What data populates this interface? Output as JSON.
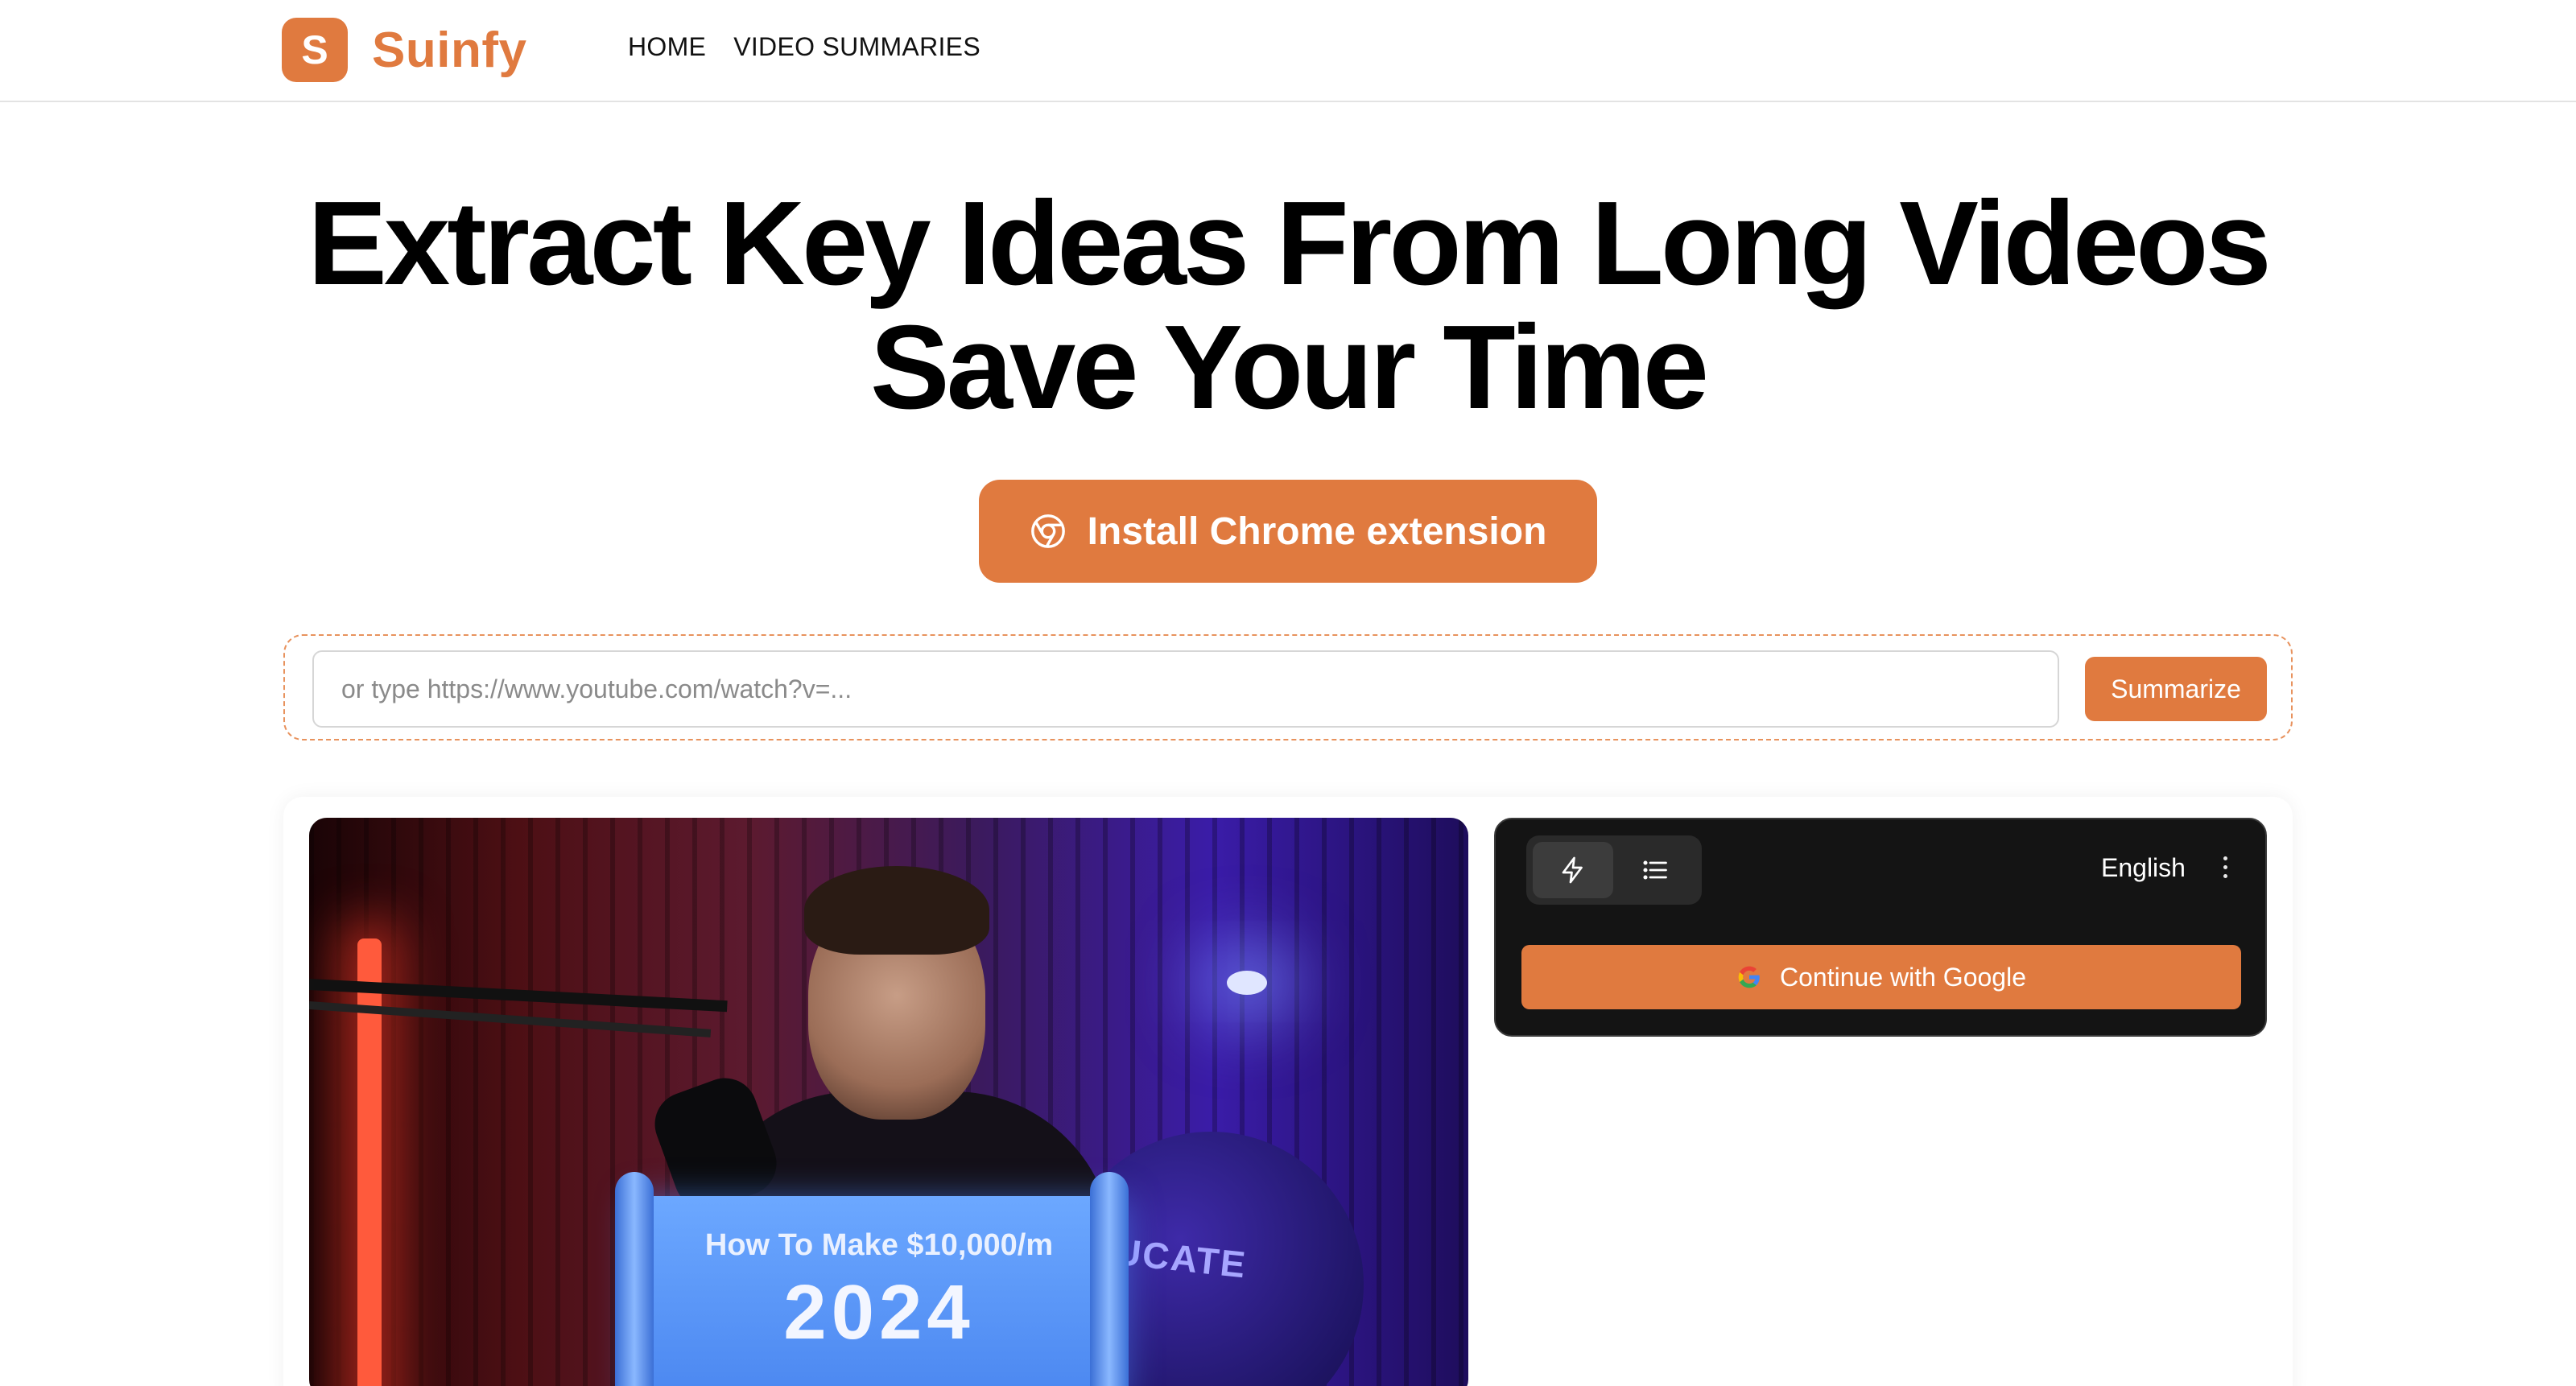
{
  "brand": {
    "logo_letter": "S",
    "name": "Suinfy",
    "accent": "#e07a3f"
  },
  "nav": {
    "items": [
      "HOME",
      "VIDEO SUMMARIES"
    ]
  },
  "hero": {
    "line1": "Extract Key Ideas From Long Videos",
    "line2": "Save Your Time"
  },
  "cta": {
    "label": "Install Chrome extension",
    "icon": "chrome-icon"
  },
  "search": {
    "placeholder": "or type https://www.youtube.com/watch?v=...",
    "value": "",
    "button_label": "Summarize"
  },
  "video": {
    "banner_line1": "How To Make $10,000/m",
    "banner_line2": "2024",
    "background_text": "UCATE"
  },
  "panel": {
    "mode_icons": [
      "lightning-icon",
      "list-icon"
    ],
    "active_mode": "lightning-icon",
    "language": "English",
    "google_button": "Continue with Google"
  }
}
